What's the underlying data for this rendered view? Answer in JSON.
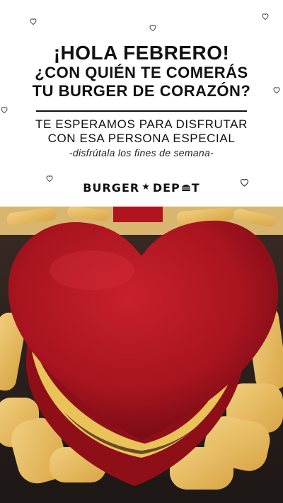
{
  "headline": {
    "line1": "¡HOLA FEBRERO!",
    "line2": "¿CON QUIÉN TE COMERÁS",
    "line3": "TU BURGER DE CORAZÓN?"
  },
  "subheadline": {
    "line1": "TE ESPERAMOS PARA DISFRUTAR",
    "line2": "CON ESA PERSONA ESPECIAL"
  },
  "tagline": "-disfrútala los fines de semana-",
  "brand": {
    "part1": "BURGER",
    "part2": "DEP",
    "part3": "T"
  },
  "colors": {
    "bun": "#b01a24",
    "cheese": "#e9c25a",
    "fries": "#e7bd63",
    "background": "#ffffff"
  },
  "icons": [
    "heart-outline-icon",
    "star-icon",
    "burger-icon"
  ]
}
